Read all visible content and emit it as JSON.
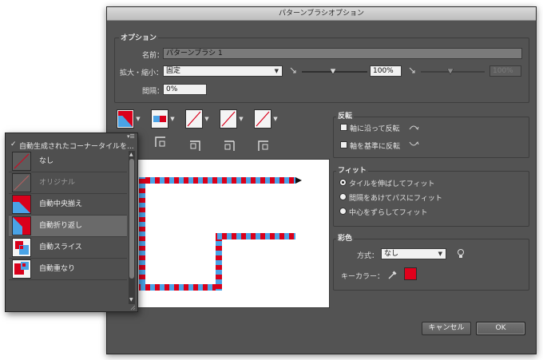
{
  "dialog": {
    "title": "パターンブラシオプション",
    "options_group": "オプション",
    "name_label": "名前：",
    "name_value": "パターンブラシ 1",
    "scale_label": "拡大・縮小：",
    "scale_value": "固定",
    "scale_percent": "100%",
    "scale_percent2": "100%",
    "spacing_label": "間隔：",
    "spacing_value": "0%",
    "flip_group": "反転",
    "flip_along": "軸に沿って反転",
    "flip_across": "軸を基準に反転",
    "fit_group": "フィット",
    "fit_options": [
      "タイルを伸ばしてフィット",
      "間隔をあけてパスにフィット",
      "中心をずらしてフィット"
    ],
    "colorization_group": "彩色",
    "method_label": "方式：",
    "method_value": "なし",
    "key_color_label": "キーカラー：",
    "key_color": "#e0001b",
    "cancel_label": "キャンセル",
    "ok_label": "OK"
  },
  "popup": {
    "header": "自動生成されたコーナータイルを...",
    "items": [
      {
        "label": "なし"
      },
      {
        "label": "オリジナル"
      },
      {
        "label": "自動中央揃え"
      },
      {
        "label": "自動折り返し"
      },
      {
        "label": "自動スライス"
      },
      {
        "label": "自動重なり"
      }
    ]
  },
  "colors": {
    "red": "#d9001b",
    "blue": "#4aa3e6",
    "dialog_bg": "#535353",
    "popup_bg": "#4f4f4f"
  }
}
